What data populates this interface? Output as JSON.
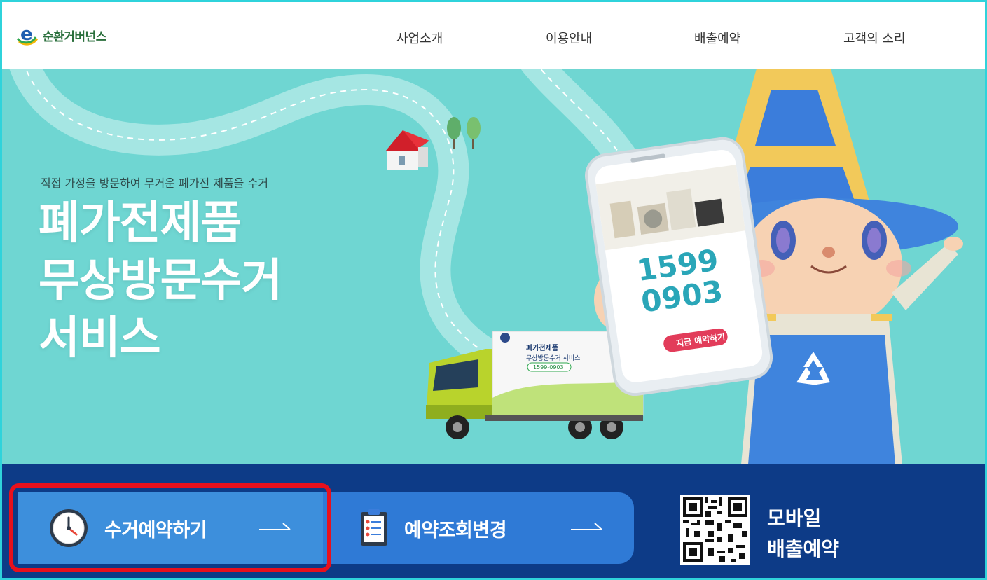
{
  "header": {
    "logo_text": "순환거버넌스",
    "logo_letter": "e",
    "nav": [
      "사업소개",
      "이용안내",
      "배출예약",
      "고객의 소리"
    ]
  },
  "hero": {
    "subtitle": "직접 가정을 방문하여 무거운 폐가전 제품을 수거",
    "title_lines": [
      "폐가전제품",
      "무상방문수거",
      "서비스"
    ],
    "phone_number_line1": "1599",
    "phone_number_line2": "0903",
    "phone_cta": "지금 예약하기",
    "truck_line1": "폐가전제품",
    "truck_line2": "무상방문수거 서비스",
    "truck_phone": "1599-0903"
  },
  "bottom": {
    "reserve_label": "수거예약하기",
    "check_label": "예약조회변경",
    "mobile_line1": "모바일",
    "mobile_line2": "배출예약"
  },
  "colors": {
    "hero_bg": "#6fd6d2",
    "bottom_bg": "#0d3b87",
    "reserve_btn": "#3d8fdc",
    "check_btn": "#2f7ad6",
    "highlight": "#e8101c",
    "frame": "#2fd3db"
  }
}
